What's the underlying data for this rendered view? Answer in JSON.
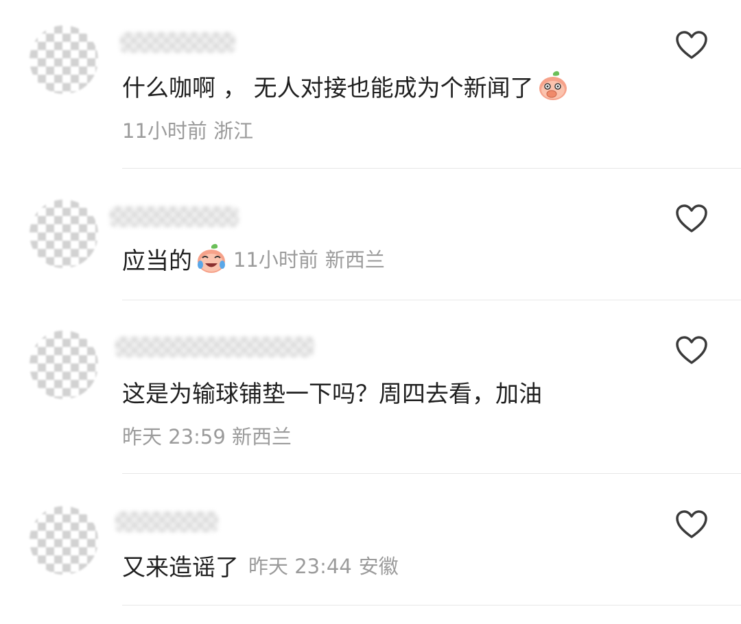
{
  "comments": [
    {
      "text": "什么咖啊 ， 无人对接也能成为个新闻了",
      "emoji": "covering-mouth-peach-emoji",
      "time": "11小时前",
      "location": "浙江"
    },
    {
      "text": "应当的",
      "emoji": "crying-laughing-peach-emoji",
      "time": "11小时前",
      "location": "新西兰"
    },
    {
      "text": "这是为输球铺垫一下吗？周四去看，加油",
      "time": "昨天 23:59",
      "location": "新西兰"
    },
    {
      "text": "又来造谣了",
      "time": "昨天 23:44",
      "location": "安徽"
    }
  ],
  "icons": {
    "like": "heart-outline-icon"
  },
  "colors": {
    "text": "#1f1f1f",
    "meta": "#9b9b9b",
    "divider": "#e7e7e7",
    "emoji_face": "#f6a28a"
  }
}
